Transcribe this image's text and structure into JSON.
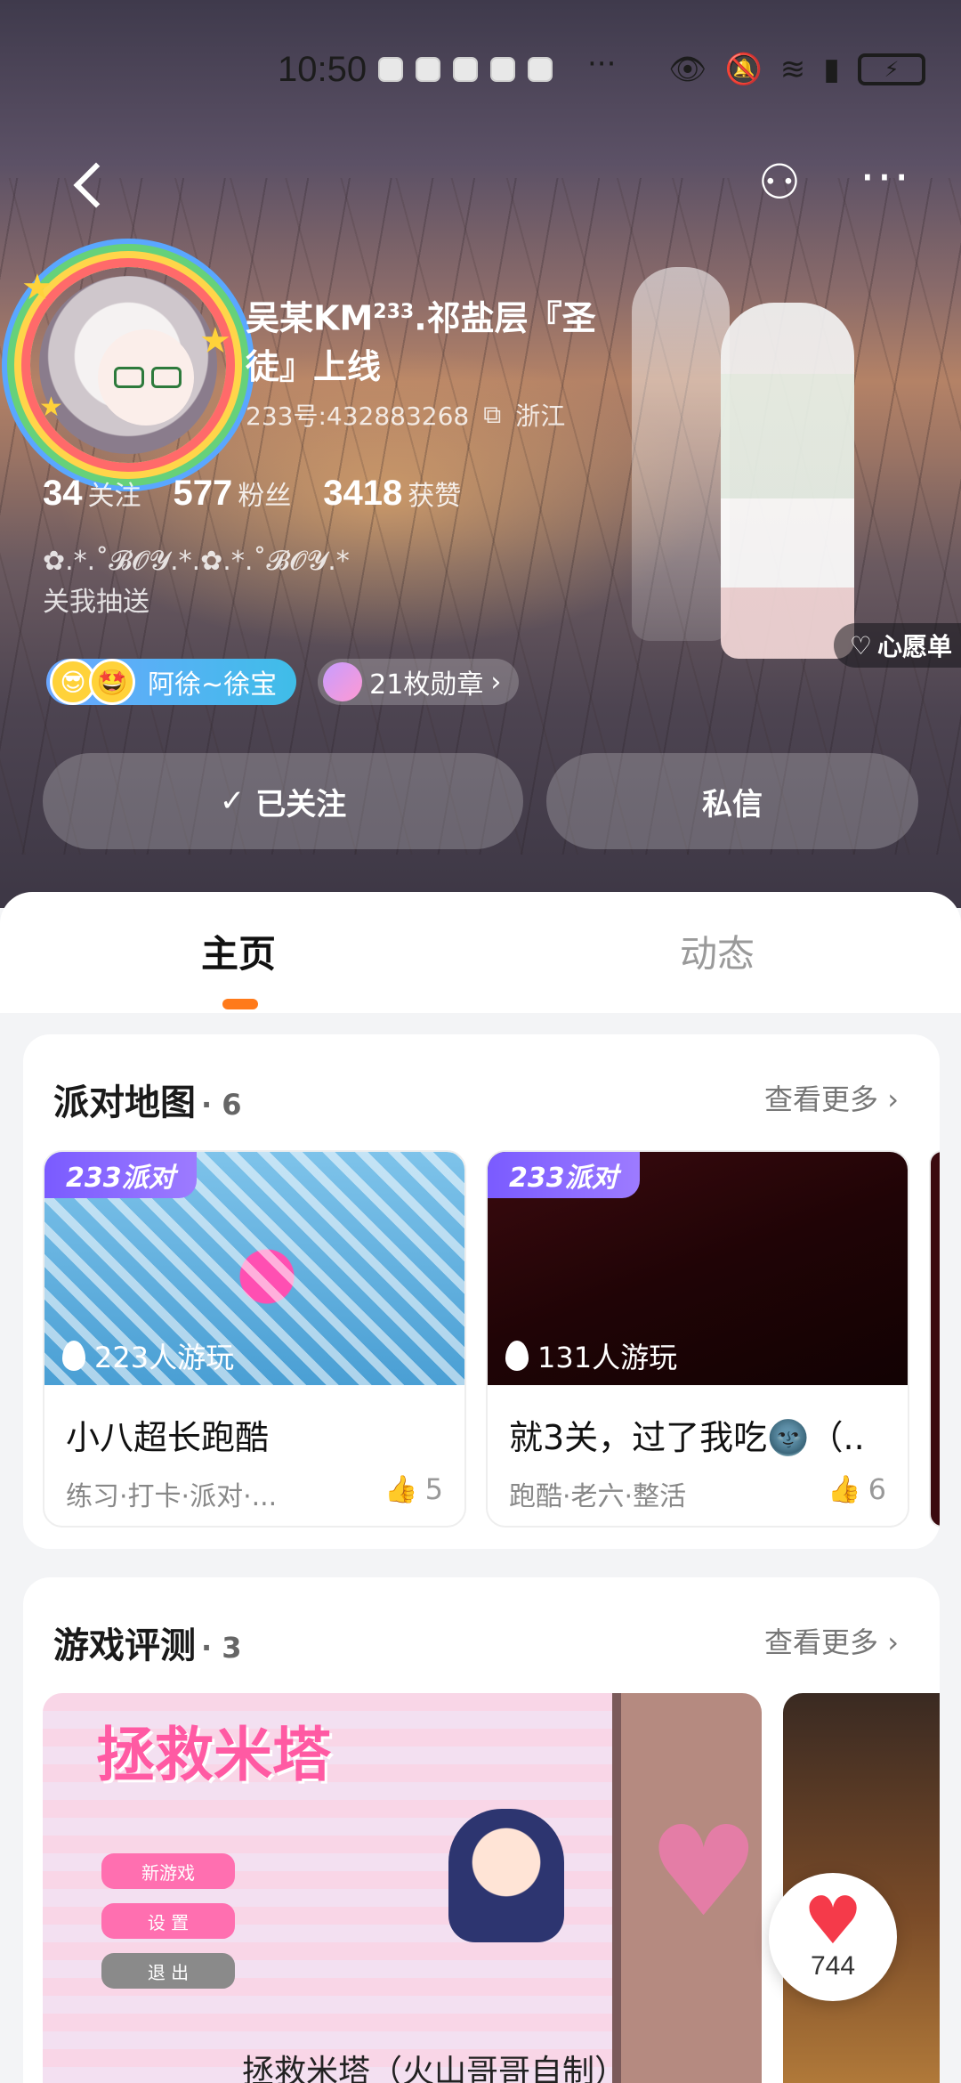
{
  "status_bar": {
    "time": "10:50",
    "more_dots": "···",
    "battery": "⚡"
  },
  "profile": {
    "name_main": "吴某KM",
    "name_sup": "233",
    "name_rest": ".祁盐层『圣徒』上线",
    "id_text": "233号:432883268",
    "location": "浙江",
    "stats": [
      {
        "num": "34",
        "label": "关注"
      },
      {
        "num": "577",
        "label": "粉丝"
      },
      {
        "num": "3418",
        "label": "获赞"
      }
    ],
    "bio_line1": "✿.*.˚𝓑𝓞𝓨.*.✿.*.˚𝓑𝓞𝓨.*",
    "bio_line2": "关我抽送",
    "friend_chip": "阿徐~徐宝",
    "medal_chip": "21枚勋章",
    "wish_chip": "心愿单",
    "btn_follow": "已关注",
    "btn_message": "私信"
  },
  "tabs": {
    "home": "主页",
    "feed": "动态"
  },
  "party_section": {
    "title": "派对地图",
    "count": "· 6",
    "more": "查看更多",
    "cards": [
      {
        "tag": "233派对",
        "players": "223人游玩",
        "name": "小八超长跑酷",
        "tags": "练习·打卡·派对·...",
        "likes": "5"
      },
      {
        "tag": "233派对",
        "players": "131人游玩",
        "name": "就3关，过了我吃🌚（..",
        "tags": "跑酷·老六·整活",
        "likes": "6"
      }
    ]
  },
  "review_section": {
    "title": "游戏评测",
    "count": "· 3",
    "more": "查看更多",
    "game_logo": "拯救米塔",
    "menu": [
      "新游戏",
      "设 置",
      "退 出"
    ],
    "card_title": "拯救米塔（火山哥哥自制）"
  },
  "like_button": {
    "count": "744"
  },
  "colors": {
    "accent": "#ff7a1a",
    "tag_purple": "#7a5bff",
    "like_red": "#f53a4a"
  }
}
